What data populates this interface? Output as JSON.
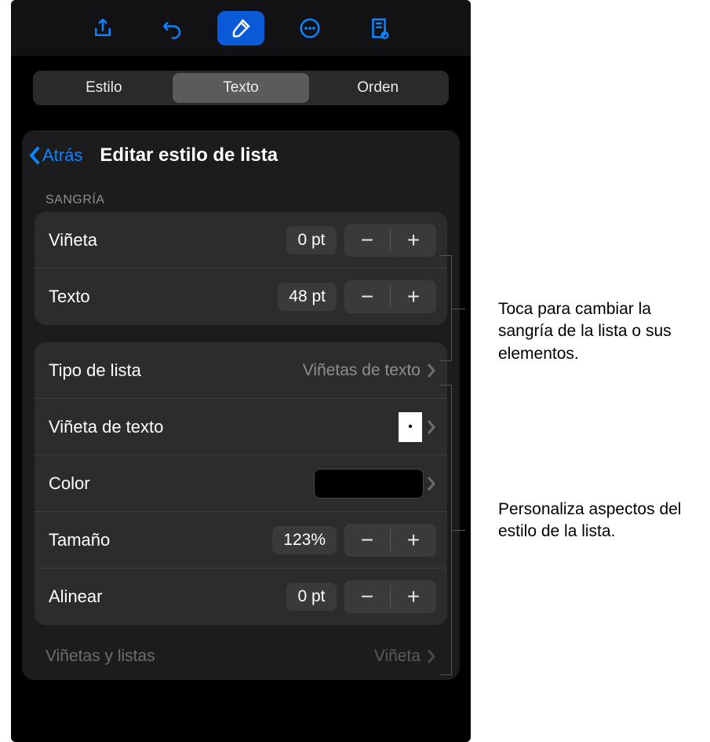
{
  "toolbar": {
    "icons": [
      "share-icon",
      "undo-icon",
      "brush-icon",
      "more-icon",
      "notes-icon"
    ],
    "active_index": 2
  },
  "segments": {
    "items": [
      "Estilo",
      "Texto",
      "Orden"
    ],
    "selected_index": 1
  },
  "nav": {
    "back_label": "Atrás",
    "title": "Editar estilo de lista"
  },
  "indent": {
    "section_label": "SANGRÍA",
    "rows": [
      {
        "label": "Viñeta",
        "value": "0 pt"
      },
      {
        "label": "Texto",
        "value": "48 pt"
      }
    ]
  },
  "style": {
    "list_type": {
      "label": "Tipo de lista",
      "value": "Viñetas de texto"
    },
    "text_bullet": {
      "label": "Viñeta de texto",
      "glyph": "•"
    },
    "color": {
      "label": "Color",
      "swatch": "#000000"
    },
    "size": {
      "label": "Tamaño",
      "value": "123%"
    },
    "align": {
      "label": "Alinear",
      "value": "0 pt"
    }
  },
  "peek": {
    "label": "Viñetas y listas",
    "value": "Viñeta"
  },
  "callouts": {
    "c1": "Toca para cambiar la sangría de la lista o sus elementos.",
    "c2": "Personaliza aspectos del estilo de la lista."
  }
}
